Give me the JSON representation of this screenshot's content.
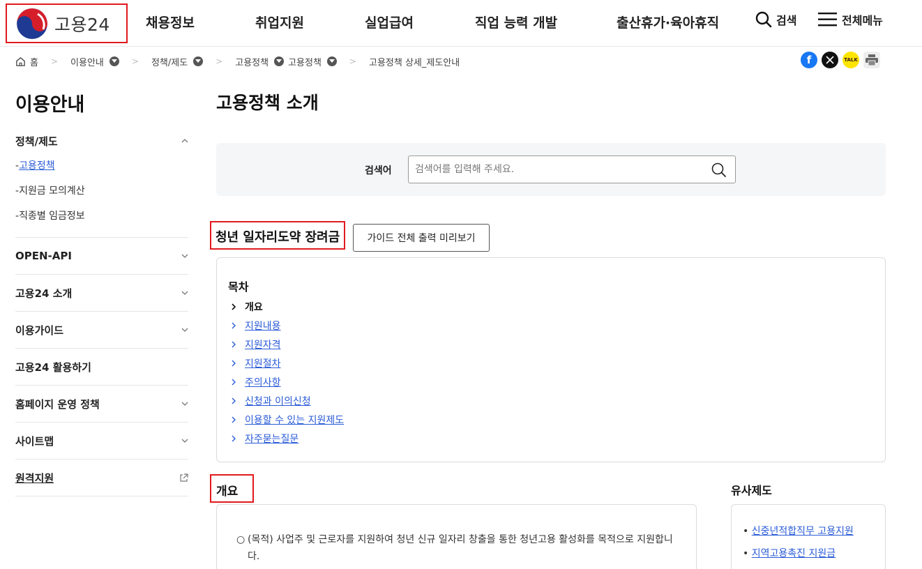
{
  "header": {
    "logo_text": "고용24",
    "gnb": [
      "채용정보",
      "취업지원",
      "실업급여",
      "직업 능력 개발",
      "출산휴가·육아휴직"
    ],
    "search_label": "검색",
    "menu_label": "전체메뉴"
  },
  "breadcrumb": {
    "home": "홈",
    "items": [
      "이용안내",
      "정책/제도",
      "고용정책",
      "고용정책",
      "고용정책 상세_제도안내"
    ]
  },
  "share": {
    "kakao_label": "TALK"
  },
  "sidebar": {
    "title": "이용안내",
    "groups": [
      {
        "label": "정책/제도",
        "sub": [
          "고용정책",
          "지원금 모의계산",
          "직종별 임금정보"
        ]
      },
      {
        "label": "OPEN-API"
      },
      {
        "label": "고용24 소개"
      },
      {
        "label": "이용가이드"
      },
      {
        "label": "고용24 활용하기"
      },
      {
        "label": "홈페이지 운영 정책"
      },
      {
        "label": "사이트맵"
      },
      {
        "label": "원격지원"
      }
    ]
  },
  "main": {
    "page_title": "고용정책 소개",
    "search": {
      "label": "검색어",
      "placeholder": "검색어를 입력해 주세요."
    },
    "policy_title": "청년 일자리도약 장려금",
    "guide_button": "가이드 전체 출력 미리보기",
    "toc": {
      "title": "목차",
      "items": [
        "개요",
        "지원내용",
        "지원자격",
        "지원절차",
        "주의사항",
        "신청과 이의신청",
        "이용할 수 있는 지원제도",
        "자주묻는질문"
      ]
    },
    "overview": {
      "title": "개요",
      "text": "(목적) 사업주 및 근로자를 지원하여 청년 신규 일자리 창출을 통한 청년고용 활성화를 목적으로 지원합니다."
    },
    "similar": {
      "title": "유사제도",
      "items": [
        "신중년적합직무 고용지원",
        "지역고용촉진 지원금"
      ]
    }
  }
}
